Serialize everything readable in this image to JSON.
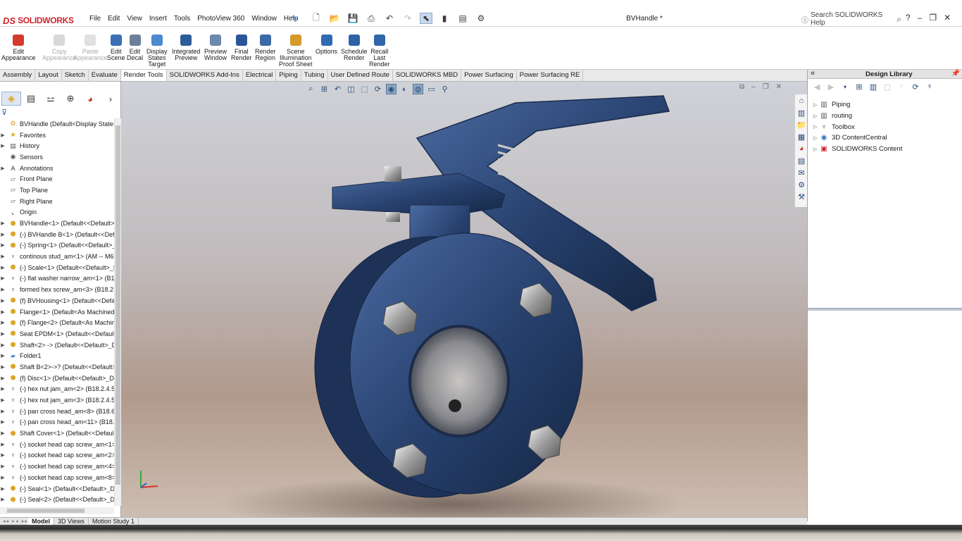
{
  "app": {
    "logo_mark": "DS",
    "logo_word": "SOLIDWORKS",
    "document_title": "BVHandle *"
  },
  "menu": [
    "File",
    "Edit",
    "View",
    "Insert",
    "Tools",
    "PhotoView 360",
    "Window",
    "Help"
  ],
  "help_search": {
    "placeholder": "Search SOLIDWORKS Help"
  },
  "ribbon": [
    {
      "label": "Edit\nAppearance",
      "enabled": true,
      "color": "#d33b2c"
    },
    {
      "label": "Copy\nAppearance",
      "enabled": false,
      "color": "#d8d8d8"
    },
    {
      "label": "Paste\nAppearance",
      "enabled": false,
      "color": "#e0e0e0"
    },
    {
      "label": "Edit\nScene",
      "enabled": true,
      "color": "#3a6fb5"
    },
    {
      "label": "Edit\nDecal",
      "enabled": true,
      "color": "#6b7f98"
    },
    {
      "label": "Display\nStates\nTarget",
      "enabled": true,
      "color": "#4e8ad0"
    },
    {
      "label": "Integrated\nPreview",
      "enabled": true,
      "color": "#2c5d9a"
    },
    {
      "label": "Preview\nWindow",
      "enabled": true,
      "color": "#6a89ad"
    },
    {
      "label": "Final\nRender",
      "enabled": true,
      "color": "#2a5599"
    },
    {
      "label": "Render\nRegion",
      "enabled": true,
      "color": "#3b6aa6"
    },
    {
      "label": "Scene\nIllumination\nProof Sheet",
      "enabled": true,
      "color": "#d59a2a"
    },
    {
      "label": "Options",
      "enabled": true,
      "color": "#2f6bb2"
    },
    {
      "label": "Schedule\nRender",
      "enabled": true,
      "color": "#2d62a5"
    },
    {
      "label": "Recall\nLast\nRender",
      "enabled": true,
      "color": "#3066aa"
    }
  ],
  "tabs": [
    "Assembly",
    "Layout",
    "Sketch",
    "Evaluate",
    "Render Tools",
    "SOLIDWORKS Add-Ins",
    "Electrical",
    "Piping",
    "Tubing",
    "User Defined Route",
    "SOLIDWORKS MBD",
    "Power Surfacing",
    "Power Surfacing RE"
  ],
  "active_tab": "Render Tools",
  "feature_tree": [
    {
      "label": "BVHandle  (Default<Display State-1>)",
      "icon": "assembly-icon",
      "expander": false
    },
    {
      "label": "Favorites",
      "icon": "favorites-icon",
      "expander": true
    },
    {
      "label": "History",
      "icon": "history-icon",
      "expander": true
    },
    {
      "label": "Sensors",
      "icon": "sensors-icon",
      "expander": false
    },
    {
      "label": "Annotations",
      "icon": "annotations-icon",
      "expander": true
    },
    {
      "label": "Front Plane",
      "icon": "plane-icon",
      "expander": false
    },
    {
      "label": "Top Plane",
      "icon": "plane-icon",
      "expander": false
    },
    {
      "label": "Right Plane",
      "icon": "plane-icon",
      "expander": false
    },
    {
      "label": "Origin",
      "icon": "origin-icon",
      "expander": false
    },
    {
      "label": "BVHandle<1> (Default<<Default>",
      "icon": "part-icon",
      "expander": true
    },
    {
      "label": "(-) BVHandle B<1> (Default<<Def",
      "icon": "part-icon",
      "expander": true
    },
    {
      "label": "(-) Spring<1> (Default<<Default>_",
      "icon": "part-icon",
      "expander": true
    },
    {
      "label": "continous stud_am<1> (AM -- M6",
      "icon": "toolbox-part-icon",
      "expander": true
    },
    {
      "label": "(-) Scale<1> (Default<<Default>_D",
      "icon": "part-icon",
      "expander": true
    },
    {
      "label": "(-) flat washer narrow_am<1> (B18",
      "icon": "toolbox-part-icon",
      "expander": true
    },
    {
      "label": "formed hex screw_am<3> (B18.2.3",
      "icon": "toolbox-part-icon",
      "expander": true
    },
    {
      "label": "(f) BVHousing<1> (Default<<Defa",
      "icon": "part-icon",
      "expander": true
    },
    {
      "label": "Flange<1> (Default<As Machined:",
      "icon": "part-icon",
      "expander": true
    },
    {
      "label": "(f) Flange<2> (Default<As Machin",
      "icon": "part-icon",
      "expander": true
    },
    {
      "label": "Seat EPDM<1> (Default<<Default:",
      "icon": "part-icon",
      "expander": true
    },
    {
      "label": "Shaft<2> -> (Default<<Default>_D",
      "icon": "part-icon",
      "expander": true
    },
    {
      "label": "Folder1",
      "icon": "folder-icon",
      "expander": true
    },
    {
      "label": "Shaft B<2>->? (Default<<Default>",
      "icon": "part-icon",
      "expander": true
    },
    {
      "label": "(f) Disc<1> (Default<<Default>_Di",
      "icon": "part-icon",
      "expander": true
    },
    {
      "label": "(-) hex nut jam_am<2> (B18.2.4.5M",
      "icon": "toolbox-part-icon",
      "expander": true
    },
    {
      "label": "(-) hex nut jam_am<3> (B18.2.4.5M",
      "icon": "toolbox-part-icon",
      "expander": true
    },
    {
      "label": "(-) pan cross head_am<8> (B18.6.7",
      "icon": "toolbox-part-icon",
      "expander": true
    },
    {
      "label": "(-) pan cross head_am<11> (B18.6",
      "icon": "toolbox-part-icon",
      "expander": true
    },
    {
      "label": "Shaft  Cover<1> (Default<<Defaul",
      "icon": "part-icon",
      "expander": true
    },
    {
      "label": "(-) socket head cap screw_am<1>",
      "icon": "toolbox-part-icon",
      "expander": true
    },
    {
      "label": "(-) socket head cap screw_am<2>",
      "icon": "toolbox-part-icon",
      "expander": true
    },
    {
      "label": "(-) socket head cap screw_am<4>",
      "icon": "toolbox-part-icon",
      "expander": true
    },
    {
      "label": "(-) socket head cap screw_am<8>",
      "icon": "toolbox-part-icon",
      "expander": true
    },
    {
      "label": "(-) Seal<1> (Default<<Default>_Di",
      "icon": "part-icon",
      "expander": true
    },
    {
      "label": "(-) Seal<2> (Default<<Default>_Di",
      "icon": "part-icon",
      "expander": true
    }
  ],
  "bottom_tabs": [
    "Model",
    "3D Views",
    "Motion Study 1"
  ],
  "active_bottom_tab": "Model",
  "design_library": {
    "title": "Design Library",
    "items": [
      {
        "label": "Piping",
        "icon": "library-folder-icon"
      },
      {
        "label": "routing",
        "icon": "library-folder-icon"
      },
      {
        "label": "Toolbox",
        "icon": "toolbox-icon"
      },
      {
        "label": "3D ContentCentral",
        "icon": "content-central-icon"
      },
      {
        "label": "SOLIDWORKS Content",
        "icon": "solidworks-content-icon"
      }
    ]
  },
  "colors": {
    "accent": "#d0222b",
    "selection": "#c9d8ec",
    "valve_blue": "#27406e"
  }
}
